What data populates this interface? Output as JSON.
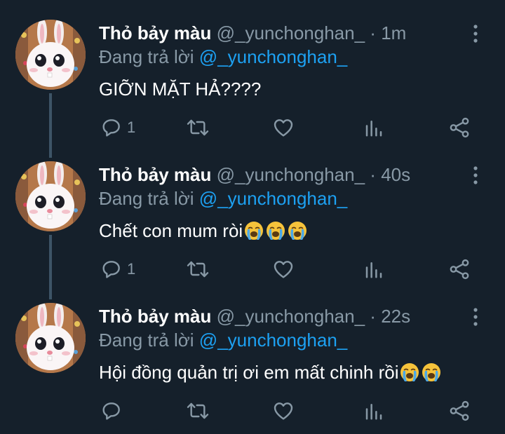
{
  "colors": {
    "background": "#15202b",
    "text": "#ffffff",
    "muted": "#8899a6",
    "mention": "#1da1f2",
    "thread_line": "#3d5466"
  },
  "icons": {
    "reply": "reply-icon",
    "retweet": "retweet-icon",
    "like": "heart-icon",
    "stats": "stats-icon",
    "share": "share-icon",
    "more": "more-icon",
    "emoji": "loudly-crying-face-emoji"
  },
  "tweets": [
    {
      "name": "Thỏ bảy màu",
      "handle": "@_yunchonghan_",
      "separator": "·",
      "time": "1m",
      "reply_prefix": "Đang trả lời",
      "reply_mention": "@_yunchonghan_",
      "text": "GIỠN MẶT HẢ????",
      "emoji_count": 0,
      "reply_count": "1"
    },
    {
      "name": "Thỏ bảy màu",
      "handle": "@_yunchonghan_",
      "separator": "·",
      "time": "40s",
      "reply_prefix": "Đang trả lời",
      "reply_mention": "@_yunchonghan_",
      "text": "Chết con mum ròi",
      "emoji_count": 3,
      "reply_count": "1"
    },
    {
      "name": "Thỏ bảy màu",
      "handle": "@_yunchonghan_",
      "separator": "·",
      "time": "22s",
      "reply_prefix": "Đang trả lời",
      "reply_mention": "@_yunchonghan_",
      "text": "Hội đồng quản trị ơi em mất chinh rồi",
      "emoji_count": 2,
      "reply_count": ""
    }
  ]
}
